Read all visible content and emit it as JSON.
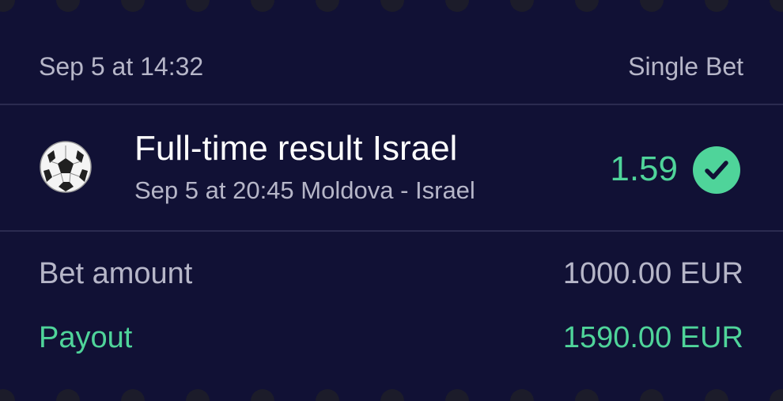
{
  "header": {
    "placed_at": "Sep 5 at 14:32",
    "bet_type": "Single Bet"
  },
  "selection": {
    "icon": "soccer-ball-icon",
    "market": "Full-time result Israel",
    "event_time": "Sep 5 at 20:45",
    "event_name": "Moldova - Israel",
    "event": "Sep 5 at 20:45 Moldova - Israel",
    "odds": "1.59",
    "status_icon": "check-circle-icon",
    "status_color": "#4fd49a"
  },
  "summary": {
    "amount_label": "Bet amount",
    "amount_value": "1000.00 EUR",
    "payout_label": "Payout",
    "payout_value": "1590.00 EUR"
  },
  "colors": {
    "background": "#111135",
    "accent_green": "#4fd49a",
    "muted_text": "#b6b6c8",
    "divider": "#2b2b50"
  }
}
